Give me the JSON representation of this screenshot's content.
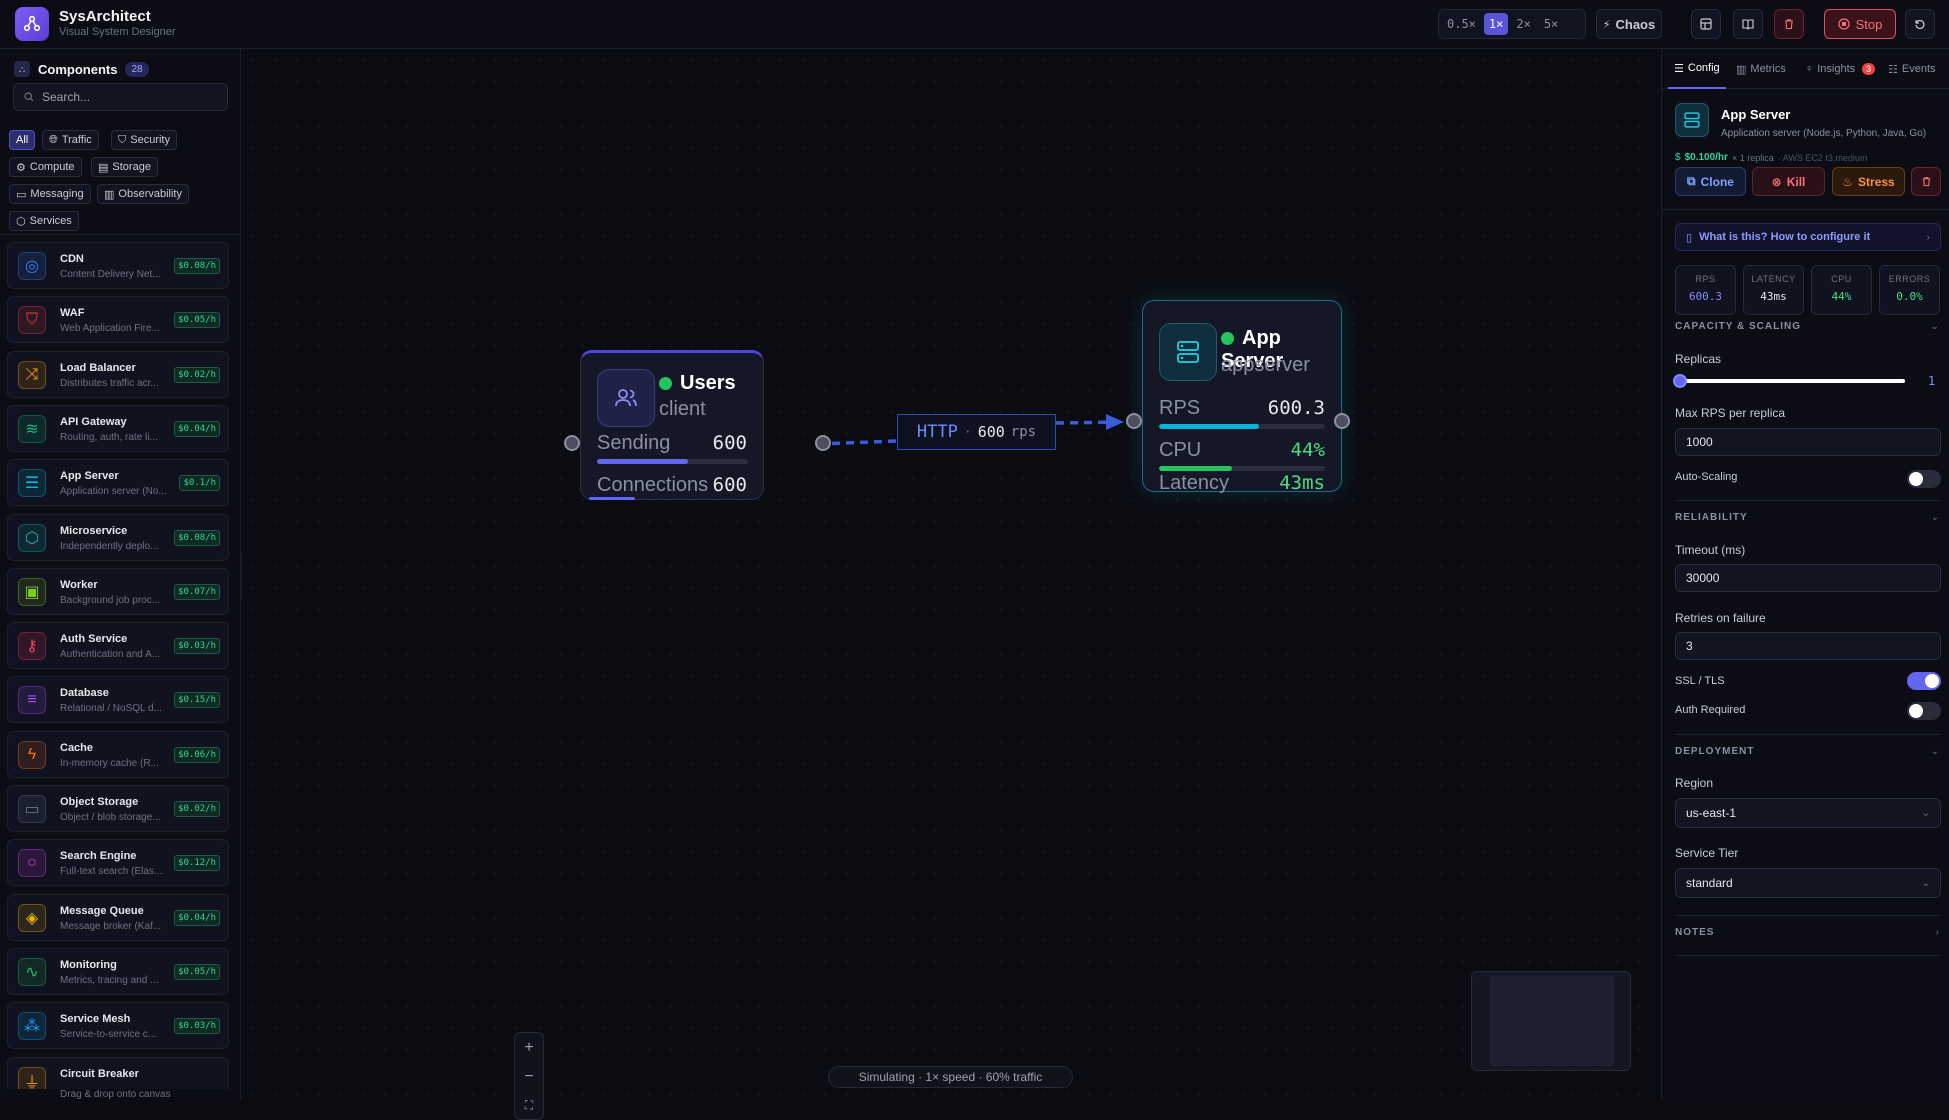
{
  "app": {
    "title": "SysArchitect",
    "subtitle": "Visual System Designer"
  },
  "toolbar": {
    "speeds": [
      "0.5×",
      "1×",
      "2×",
      "5×"
    ],
    "active_speed": "1×",
    "chaos_label": "Chaos",
    "stop_label": "Stop"
  },
  "sidebar": {
    "title": "Components",
    "count": "28",
    "search_placeholder": "Search...",
    "categories": [
      "All",
      "Traffic",
      "Security",
      "Compute",
      "Storage",
      "Messaging",
      "Observability",
      "Services"
    ],
    "items": [
      {
        "name": "CDN",
        "desc": "Content Delivery Net...",
        "price": "$0.08/h",
        "icon": "globe-icon",
        "color": "#3b82f6"
      },
      {
        "name": "WAF",
        "desc": "Web Application Fire...",
        "price": "$0.05/h",
        "icon": "shield-icon",
        "color": "#ef4444"
      },
      {
        "name": "Load Balancer",
        "desc": "Distributes traffic acr...",
        "price": "$0.02/h",
        "icon": "shuffle-icon",
        "color": "#f59e0b"
      },
      {
        "name": "API Gateway",
        "desc": "Routing, auth, rate li...",
        "price": "$0.04/h",
        "icon": "layers-icon",
        "color": "#10b981"
      },
      {
        "name": "App Server",
        "desc": "Application server (No...",
        "price": "$0.1/h",
        "icon": "server-icon",
        "color": "#06b6d4"
      },
      {
        "name": "Microservice",
        "desc": "Independently deplo...",
        "price": "$0.08/h",
        "icon": "box-icon",
        "color": "#14b8a6"
      },
      {
        "name": "Worker",
        "desc": "Background job proc...",
        "price": "$0.07/h",
        "icon": "cpu-icon",
        "color": "#84cc16"
      },
      {
        "name": "Auth Service",
        "desc": "Authentication and A...",
        "price": "$0.03/h",
        "icon": "key-icon",
        "color": "#f43f5e"
      },
      {
        "name": "Database",
        "desc": "Relational / NoSQL d...",
        "price": "$0.15/h",
        "icon": "database-icon",
        "color": "#a855f7"
      },
      {
        "name": "Cache",
        "desc": "In-memory cache (R...",
        "price": "$0.06/h",
        "icon": "bolt-icon",
        "color": "#f97316"
      },
      {
        "name": "Object Storage",
        "desc": "Object / blob storage...",
        "price": "$0.02/h",
        "icon": "hard-drive-icon",
        "color": "#64748b"
      },
      {
        "name": "Search Engine",
        "desc": "Full-text search (Elas...",
        "price": "$0.12/h",
        "icon": "search-icon",
        "color": "#d946ef"
      },
      {
        "name": "Message Queue",
        "desc": "Message broker (Kaf...",
        "price": "$0.04/h",
        "icon": "stack-icon",
        "color": "#eab308"
      },
      {
        "name": "Monitoring",
        "desc": "Metrics, tracing and ...",
        "price": "$0.05/h",
        "icon": "activity-icon",
        "color": "#22c55e"
      },
      {
        "name": "Service Mesh",
        "desc": "Service-to-service c...",
        "price": "$0.03/h",
        "icon": "network-icon",
        "color": "#0ea5e9"
      },
      {
        "name": "Circuit Breaker",
        "desc": "",
        "price": "",
        "icon": "breaker-icon",
        "color": "#f59e0b"
      }
    ],
    "drag_hint": "Drag & drop onto canvas"
  },
  "canvas": {
    "users_node": {
      "title": "Users",
      "type": "client",
      "m1_label": "Sending",
      "m1_value": "600",
      "m1_fill": 0.6,
      "m2_label": "Connections",
      "m2_value": "600"
    },
    "edge": {
      "protocol": "HTTP",
      "sep": "·",
      "rate": "600",
      "unit": "rps"
    },
    "app_node": {
      "title": "App Server",
      "type": "appserver",
      "m1_label": "RPS",
      "m1_value": "600.3",
      "m1_fill": 0.6,
      "m2_label": "CPU",
      "m2_value": "44%",
      "m2_fill": 0.44,
      "m3_label": "Latency",
      "m3_value": "43ms"
    },
    "status": "Simulating · 1× speed · 60% traffic"
  },
  "panel": {
    "tabs": [
      "Config",
      "Metrics",
      "Insights",
      "Events"
    ],
    "insights_badge": "3",
    "component_title": "App Server",
    "component_desc": "Application server (Node.js, Python, Java, Go)",
    "cost": "$0.100/hr",
    "replica_note": "× 1 replica",
    "instance_note": "· AWS EC2 t3.medium",
    "actions": {
      "clone": "Clone",
      "kill": "Kill",
      "stress": "Stress"
    },
    "help_link": "What is this? How to configure it",
    "metrics": [
      {
        "label": "RPS",
        "value": "600.3",
        "color": "#818cf8"
      },
      {
        "label": "LATENCY",
        "value": "43ms",
        "color": "#e5e7eb"
      },
      {
        "label": "CPU",
        "value": "44%",
        "color": "#4ade80"
      },
      {
        "label": "ERRORS",
        "value": "0.0%",
        "color": "#4ade80"
      }
    ],
    "capacity": {
      "title": "CAPACITY & SCALING",
      "replicas_label": "Replicas",
      "replicas_value": "1",
      "replicas_fill": 0.0,
      "max_rps_label": "Max RPS per replica",
      "max_rps_value": "1000",
      "autoscaling_label": "Auto-Scaling",
      "autoscaling_on": false
    },
    "reliability": {
      "title": "RELIABILITY",
      "timeout_label": "Timeout (ms)",
      "timeout_value": "30000",
      "retries_label": "Retries on failure",
      "retries_value": "3",
      "ssl_label": "SSL / TLS",
      "ssl_on": true,
      "auth_label": "Auth Required",
      "auth_on": false
    },
    "deployment": {
      "title": "DEPLOYMENT",
      "region_label": "Region",
      "region_value": "us-east-1",
      "tier_label": "Service Tier",
      "tier_value": "standard"
    },
    "notes_title": "NOTES"
  }
}
